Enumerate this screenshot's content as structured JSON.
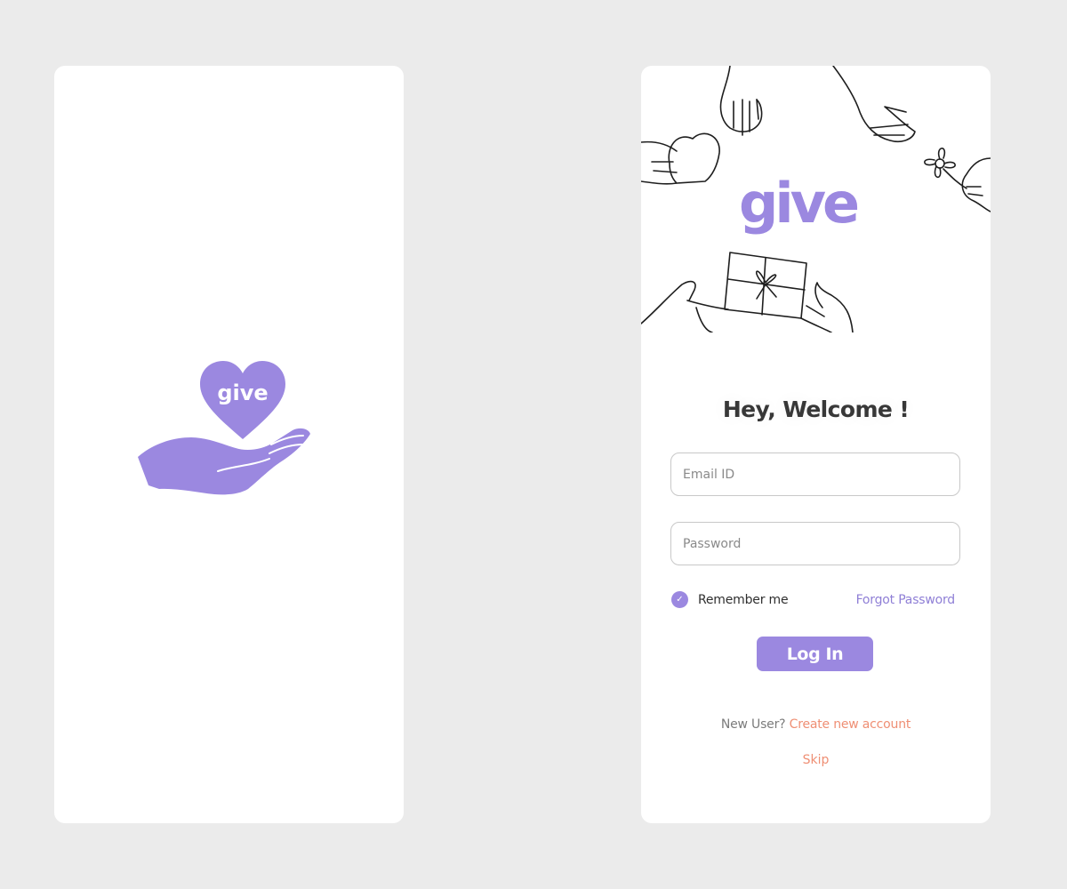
{
  "splash": {
    "logo_text": "give",
    "icon": "hand-holding-heart-icon"
  },
  "login": {
    "brand_text": "give",
    "illustration": "hands-giving-sketch",
    "title": "Hey, Welcome !",
    "email_placeholder": "Email ID",
    "password_placeholder": "Password",
    "remember_label": "Remember me",
    "remember_checked": true,
    "forgot_label": "Forgot Password",
    "login_label": "Log In",
    "new_user_text": "New User?",
    "create_account_label": "Create new account",
    "skip_label": "Skip"
  },
  "colors": {
    "background": "#ebebeb",
    "brand_purple": "#9b88e0",
    "link_purple": "#8f7fd6",
    "accent_coral": "#ef8f74",
    "title": "#383838"
  }
}
